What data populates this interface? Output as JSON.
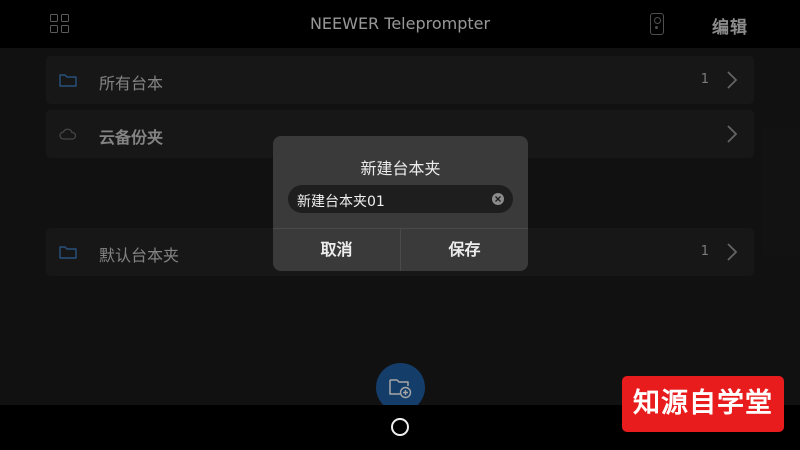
{
  "header": {
    "title": "NEEWER Teleprompter",
    "edit_label": "编辑"
  },
  "folders": [
    {
      "label": "所有台本",
      "count": "1",
      "icon": "folder-icon"
    },
    {
      "label": "云备份夹",
      "count": "",
      "icon": "cloud-icon"
    },
    {
      "label": "默认台本夹",
      "count": "1",
      "icon": "folder-icon"
    }
  ],
  "dialog": {
    "title": "新建台本夹",
    "input_value": "新建台本夹01",
    "cancel_label": "取消",
    "save_label": "保存"
  },
  "watermark": {
    "text": "知源自学堂"
  },
  "colors": {
    "accent": "#1f5fa3",
    "folder_icon": "#3f7fc2",
    "watermark_bg": "#e81c1c"
  }
}
